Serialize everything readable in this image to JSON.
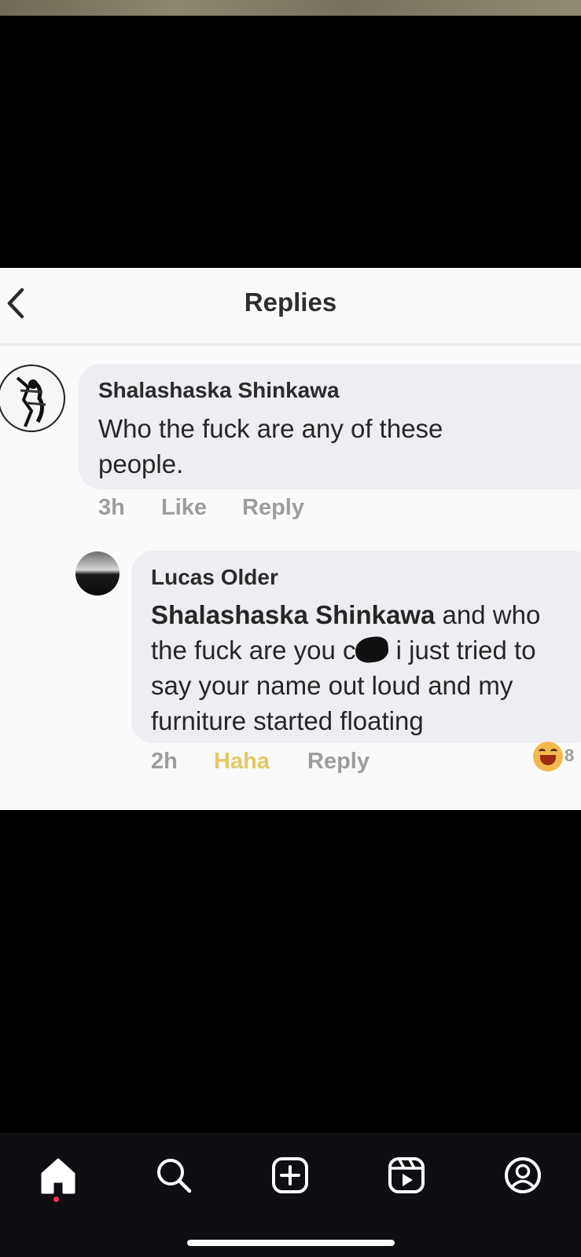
{
  "header": {
    "title": "Replies"
  },
  "comments": [
    {
      "author": "Shalashaska Shinkawa",
      "text": "Who the fuck are any of these people.",
      "time": "3h",
      "actions": [
        "Like",
        "Reply"
      ]
    },
    {
      "author": "Lucas Older",
      "mention": "Shalashaska Shinkawa",
      "text_part1": " and who the fuck are you c",
      "text_part2": " i just tried to say your name out loud and my furniture started floating",
      "time": "2h",
      "actions": [
        "Haha",
        "Reply"
      ],
      "reaction": {
        "icon": "laughing-emoji-icon",
        "count": "8"
      }
    }
  ],
  "nav": {
    "items": [
      {
        "name": "home",
        "icon": "home-icon",
        "active": true
      },
      {
        "name": "search",
        "icon": "search-icon"
      },
      {
        "name": "create",
        "icon": "plus-square-icon"
      },
      {
        "name": "reels",
        "icon": "reels-icon"
      },
      {
        "name": "profile",
        "icon": "profile-icon"
      }
    ]
  },
  "colors": {
    "background": "#000000",
    "nav_background": "#0e0e13",
    "bubble": "#edeef2",
    "haha": "#e6c766",
    "notification_dot": "#ff2d55"
  }
}
